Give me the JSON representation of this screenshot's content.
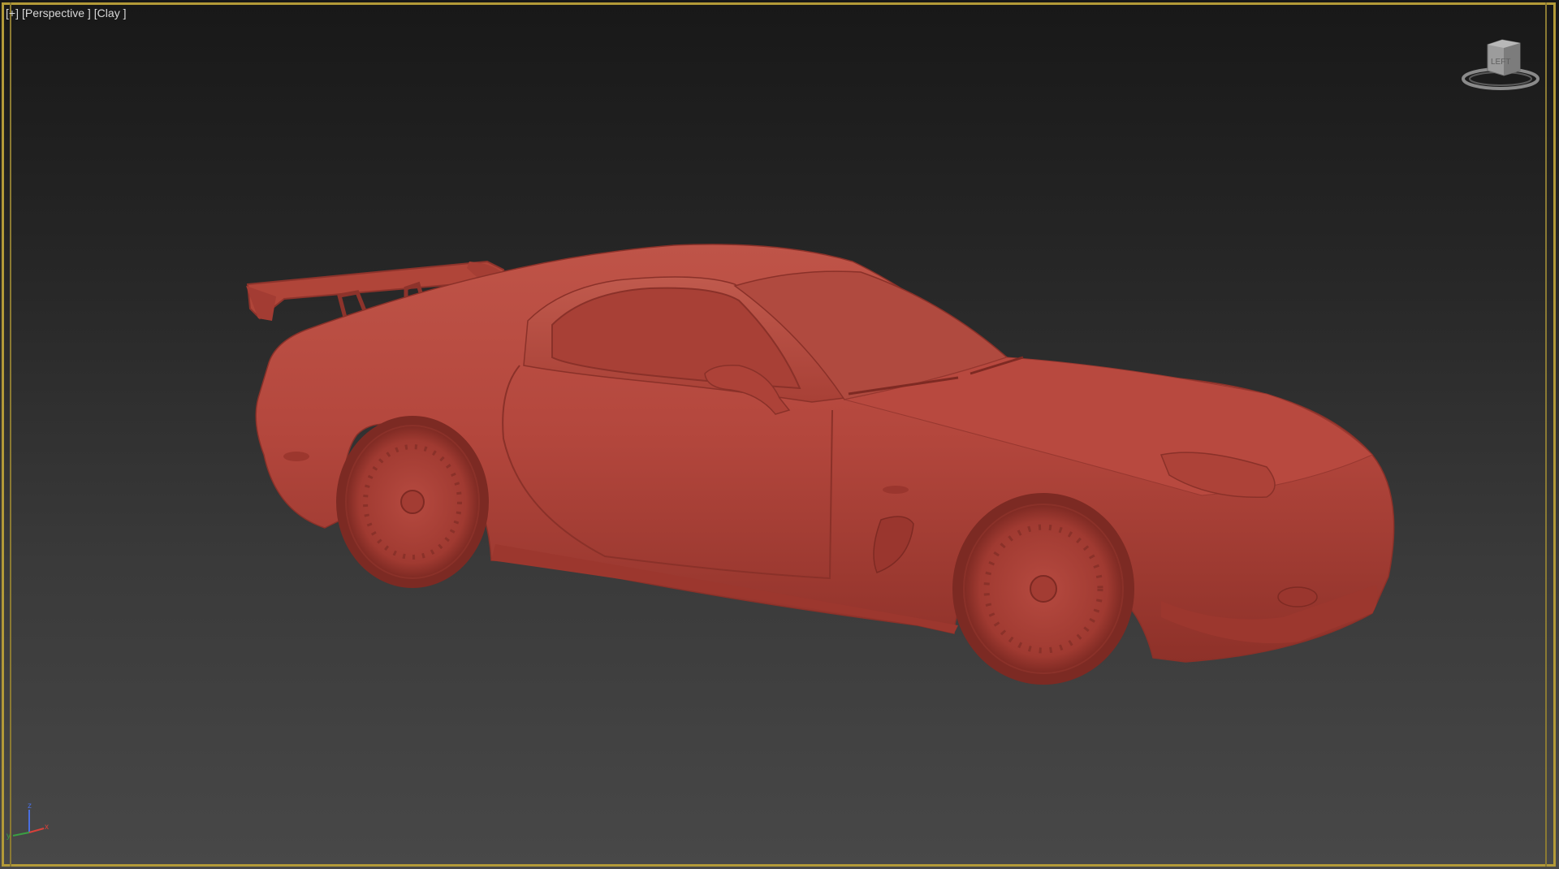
{
  "viewport": {
    "label_plus": "[+]",
    "label_view": "[Perspective ]",
    "label_shading": "[Clay ]",
    "active_border_color": "#b39a38",
    "model_color": "#b4473d"
  },
  "viewcube": {
    "face_label": "LEFT",
    "icon": "viewcube-icon"
  },
  "axis_tripod": {
    "x_label": "x",
    "y_label": "y",
    "z_label": "z",
    "x_color": "#d9413a",
    "y_color": "#3aa043",
    "z_color": "#4a6fe0"
  }
}
